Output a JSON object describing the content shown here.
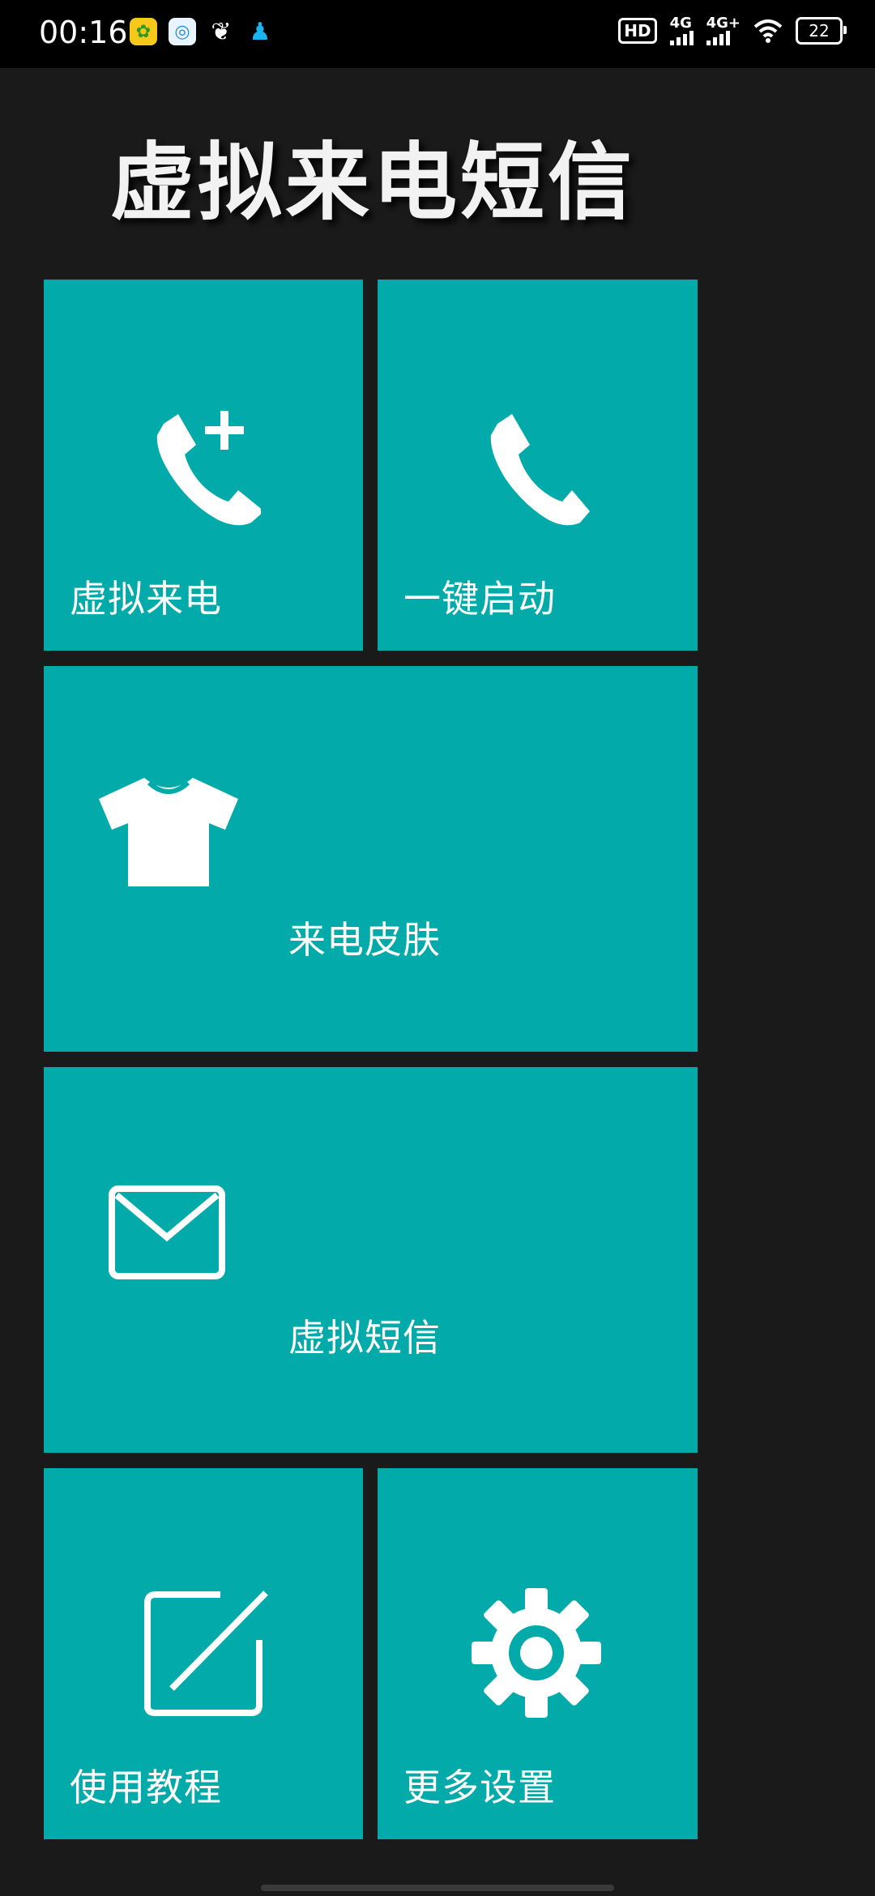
{
  "status_bar": {
    "time": "00:16",
    "hd": "HD",
    "net1": "4G",
    "net2": "4G+",
    "battery": "22"
  },
  "title": "虚拟来电短信",
  "tiles": {
    "virtual_call": "虚拟来电",
    "one_key_start": "一键启动",
    "call_skin": "来电皮肤",
    "virtual_sms": "虚拟短信",
    "tutorial": "使用教程",
    "more_settings": "更多设置"
  },
  "colors": {
    "tile": "#02aaaa",
    "background": "#1a1a1a"
  }
}
